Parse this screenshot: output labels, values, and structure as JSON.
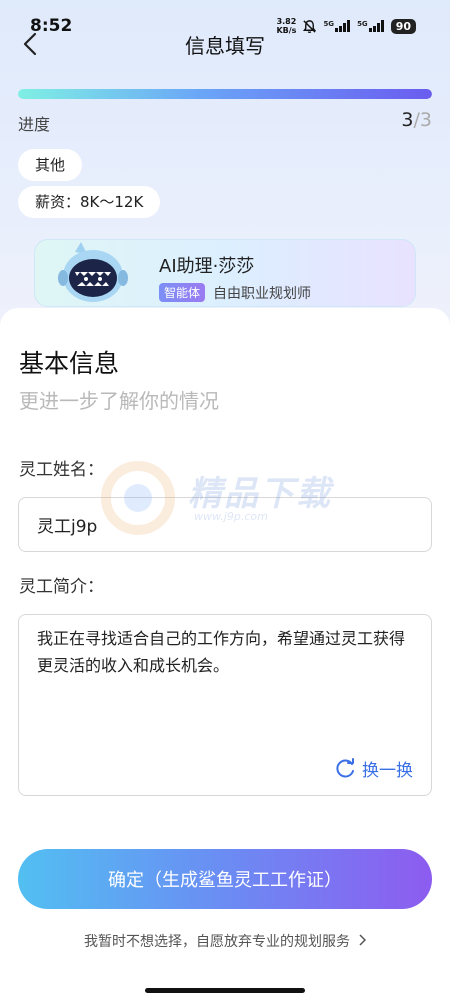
{
  "status": {
    "time": "8:52",
    "net_speed_value": "3.82",
    "net_speed_unit": "KB/s",
    "signal_1": "5G",
    "signal_2": "5G",
    "battery": "90"
  },
  "header": {
    "title": "信息填写"
  },
  "progress": {
    "label": "进度",
    "current": "3",
    "separator_total": "/3",
    "fraction": 1.0
  },
  "chips": [
    "其他",
    "薪资：8K～12K"
  ],
  "assistant": {
    "name": "AI助理·莎莎",
    "tag": "智能体",
    "role": "自由职业规划师"
  },
  "form": {
    "title": "基本信息",
    "subtitle": "更进一步了解你的情况",
    "name_label": "灵工姓名：",
    "name_value": "灵工j9p",
    "intro_label": "灵工简介：",
    "intro_value": "我正在寻找适合自己的工作方向，希望通过灵工获得更灵活的收入和成长机会。",
    "refresh_label": "换一换"
  },
  "actions": {
    "confirm_label": "确定（生成鲨鱼灵工工作证）",
    "skip_label": "我暂时不想选择，自愿放弃专业的规划服务"
  },
  "watermark": {
    "text": "精品下载",
    "url": "www.j9p.com"
  }
}
